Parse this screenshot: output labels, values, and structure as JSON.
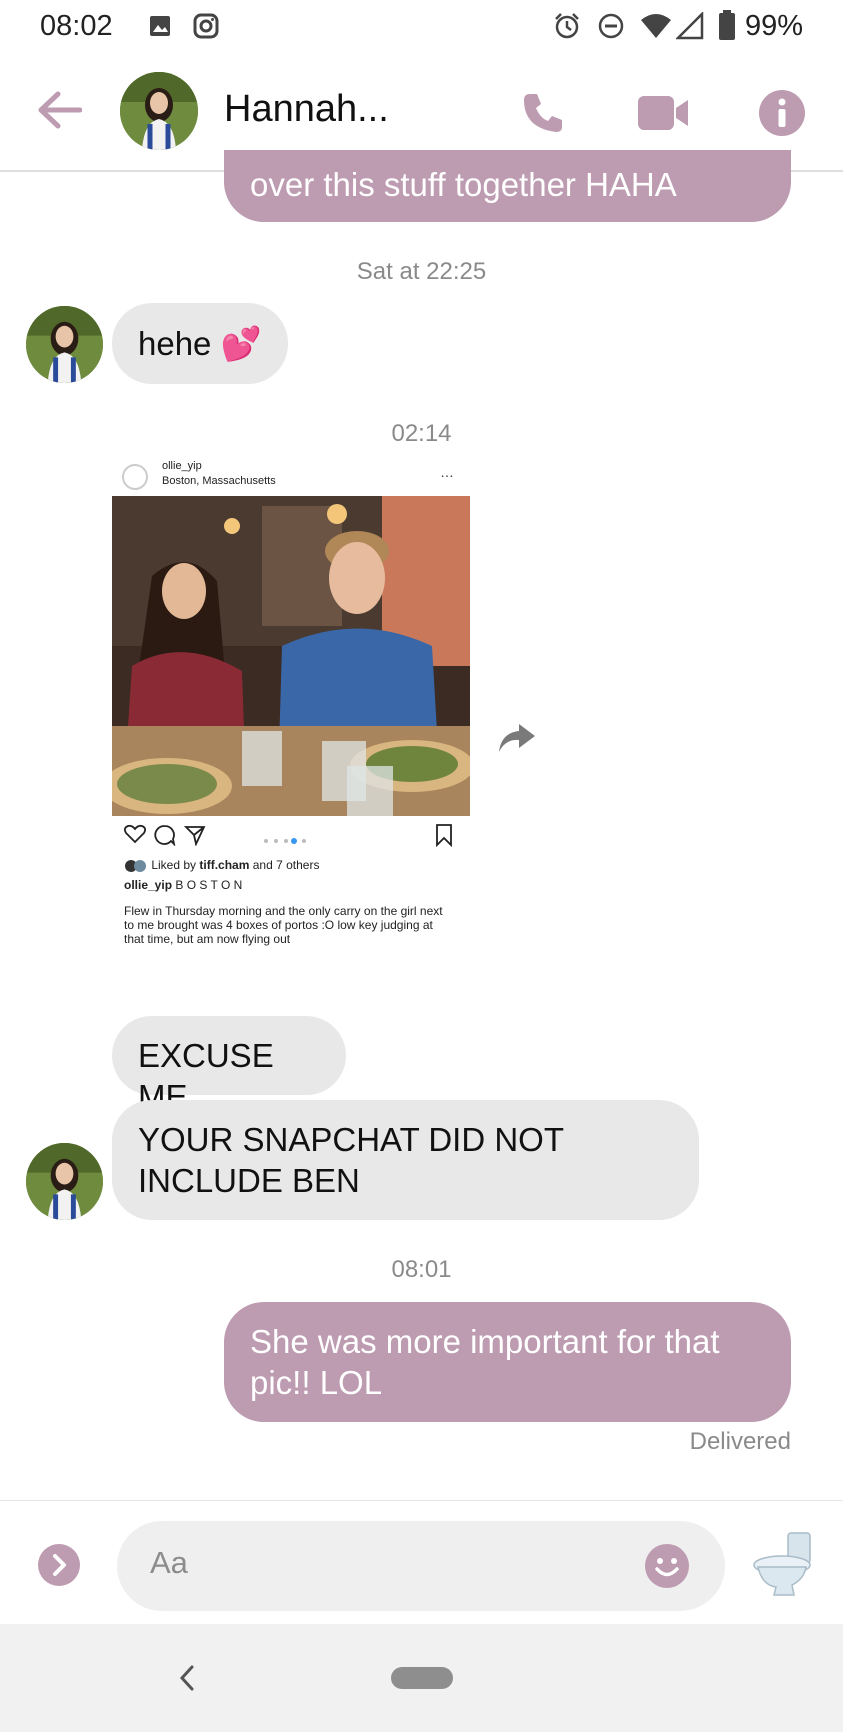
{
  "status_bar": {
    "time": "08:02",
    "battery": "99%"
  },
  "header": {
    "contact_name": "Hannah..."
  },
  "messages": {
    "prev_outgoing_tail": "over this stuff together HAHA",
    "ts1": "Sat at 22:25",
    "incoming1": "hehe",
    "incoming1_emoji": "💕",
    "ts2": "02:14",
    "post": {
      "username_top": "ollie_yip",
      "location": "Boston, Massachusetts",
      "liked_by_prefix": "Liked by ",
      "liked_by_user": "tiff.cham",
      "liked_by_suffix": " and 7 others",
      "caption_user": "ollie_yip",
      "caption_title": "B O S T O N",
      "caption_body": "Flew in Thursday morning and the only carry on the girl next to me brought was 4 boxes of portos :O low key judging at that time, but am now flying out"
    },
    "incoming2": "EXCUSE ME",
    "incoming3": "YOUR SNAPCHAT DID NOT INCLUDE BEN",
    "ts3": "08:01",
    "outgoing1": "She was more important for that pic!! LOL",
    "delivered": "Delivered"
  },
  "composer": {
    "placeholder": "Aa"
  },
  "colors": {
    "accent": "#bd9bb0",
    "incoming_bubble": "#e8e8e8"
  }
}
